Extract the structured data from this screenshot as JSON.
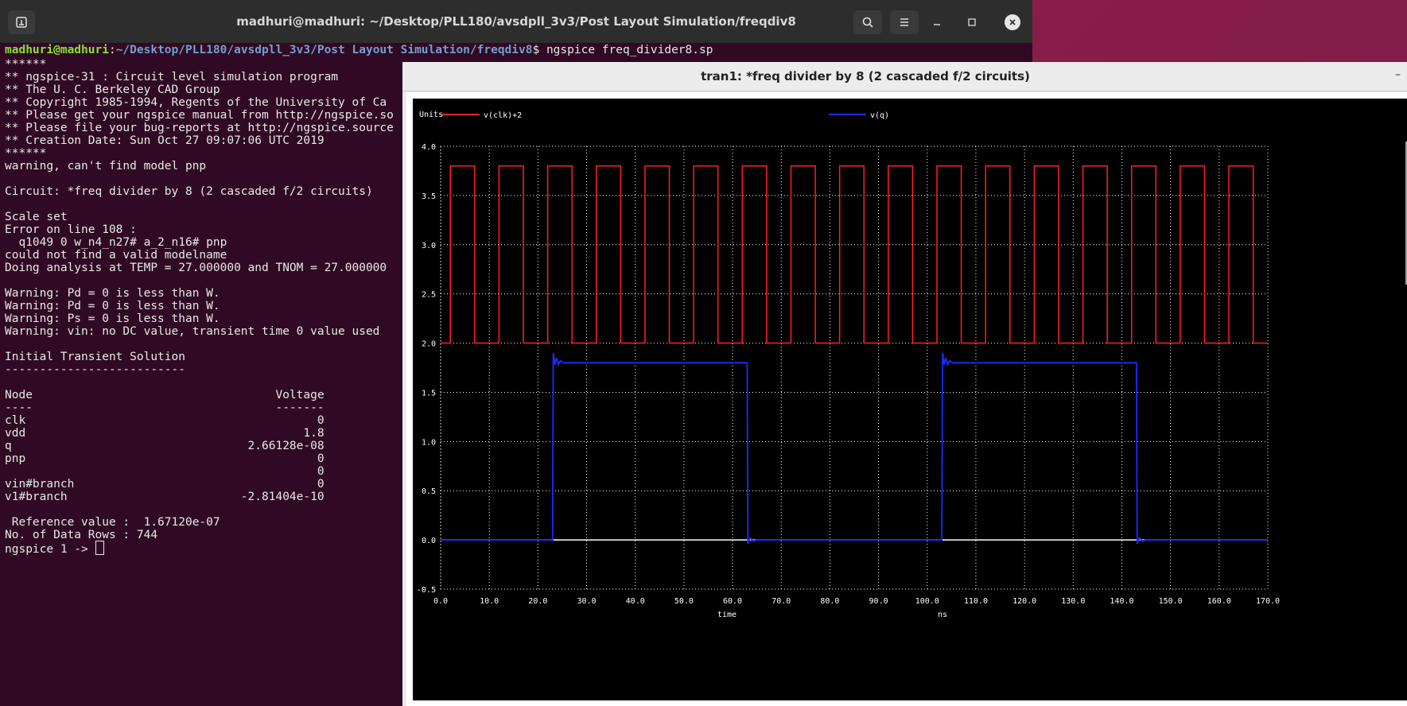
{
  "terminal": {
    "title": "madhuri@madhuri: ~/Desktop/PLL180/avsdpll_3v3/Post Layout Simulation/freqdiv8",
    "prompt_user": "madhuri@madhuri",
    "prompt_sep": ":",
    "prompt_path": "~/Desktop/PLL180/avsdpll_3v3/Post Layout Simulation/freqdiv8",
    "prompt_cmd": "$ ngspice freq_divider8.sp",
    "lines": [
      "******",
      "** ngspice-31 : Circuit level simulation program",
      "** The U. C. Berkeley CAD Group",
      "** Copyright 1985-1994, Regents of the University of Ca",
      "** Please get your ngspice manual from http://ngspice.so",
      "** Please file your bug-reports at http://ngspice.source",
      "** Creation Date: Sun Oct 27 09:07:06 UTC 2019",
      "******",
      "warning, can't find model pnp",
      "",
      "Circuit: *freq divider by 8 (2 cascaded f/2 circuits)",
      "",
      "Scale set",
      "Error on line 108 :",
      "  q1049 0 w_n4_n27# a_2_n16# pnp",
      "could not find a valid modelname",
      "Doing analysis at TEMP = 27.000000 and TNOM = 27.000000",
      "",
      "Warning: Pd = 0 is less than W.",
      "Warning: Pd = 0 is less than W.",
      "Warning: Ps = 0 is less than W.",
      "Warning: vin: no DC value, transient time 0 value used",
      "",
      "Initial Transient Solution",
      "--------------------------",
      "",
      "Node                                   Voltage",
      "----                                   -------",
      "clk                                          0",
      "vdd                                        1.8",
      "q                                  2.66128e-08",
      "pnp                                          0",
      "                                             0",
      "vin#branch                                   0",
      "v1#branch                         -2.81404e-10",
      "",
      " Reference value :  1.67120e-07",
      "No. of Data Rows : 744",
      "ngspice 1 -> "
    ]
  },
  "plot": {
    "window_title": "tran1: *freq divider by 8 (2 cascaded f/2 circuits)",
    "minimize": "–",
    "units_label": "Units",
    "x_unit_left": "time",
    "x_unit_right": "ns",
    "colors": {
      "clk": "#ff2020",
      "q": "#1a2cff",
      "grid": "#ffffff",
      "text": "#ffffff",
      "zero": "#ffffff"
    }
  },
  "chart_data": {
    "type": "line",
    "title": "tran1: *freq divider by 8 (2 cascaded f/2 circuits)",
    "xlabel": "time",
    "xunit": "ns",
    "ylabel": "Units",
    "xlim": [
      0,
      170
    ],
    "ylim": [
      -0.5,
      4.0
    ],
    "xticks": [
      0,
      10,
      20,
      30,
      40,
      50,
      60,
      70,
      80,
      90,
      100,
      110,
      120,
      130,
      140,
      150,
      160,
      170
    ],
    "yticks": [
      -0.5,
      0.0,
      0.5,
      1.0,
      1.5,
      2.0,
      2.5,
      3.0,
      3.5,
      4.0
    ],
    "grid": true,
    "legend": "top",
    "series": [
      {
        "name": "v(clk)+2",
        "low": 2.0,
        "high": 3.8,
        "rise_times": [
          2,
          12,
          22,
          32,
          42,
          52,
          62,
          72,
          82,
          92,
          102,
          112,
          122,
          132,
          142,
          152,
          162
        ],
        "fall_times": [
          7,
          17,
          27,
          37,
          47,
          57,
          67,
          77,
          87,
          97,
          107,
          117,
          127,
          137,
          147,
          157,
          167
        ]
      },
      {
        "name": "v(q)",
        "low": 0.0,
        "high": 1.8,
        "rise_times": [
          23,
          103
        ],
        "fall_times": [
          63,
          143
        ],
        "overshoot": 1.9
      }
    ]
  }
}
